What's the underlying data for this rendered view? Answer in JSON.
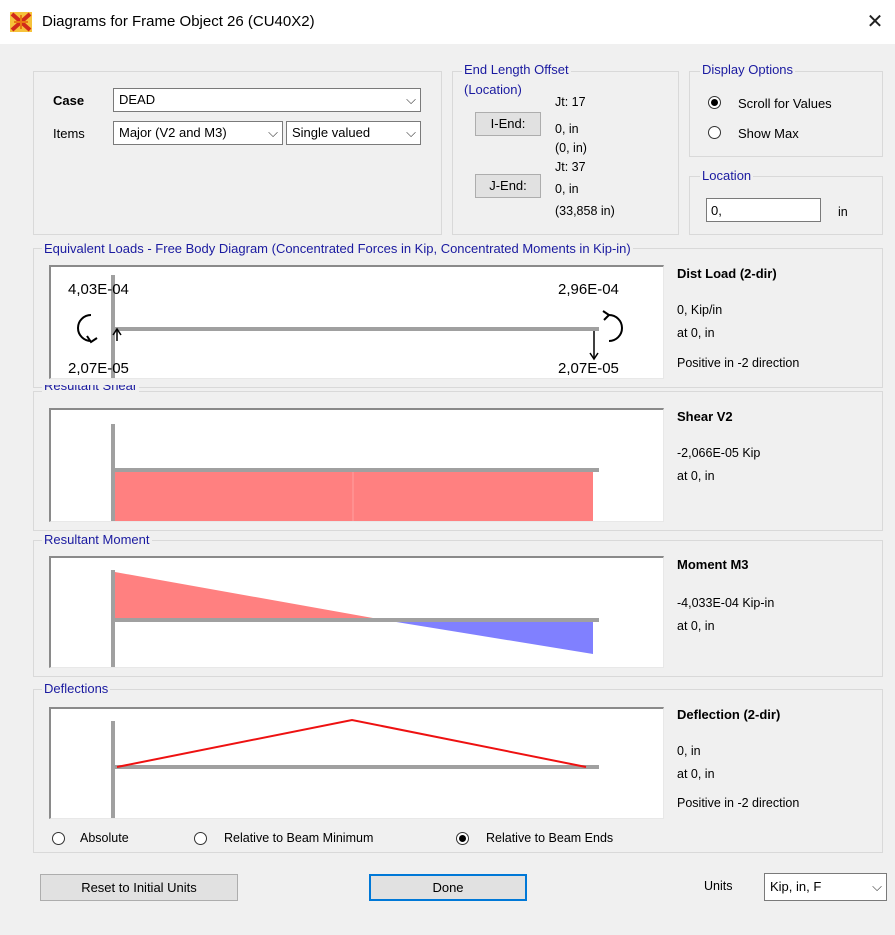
{
  "window": {
    "title": "Diagrams for Frame Object 26  (CU40X2)",
    "close_glyph": "✕"
  },
  "case": {
    "label": "Case",
    "value": "DEAD",
    "items_label": "Items",
    "items_value": "Major (V2 and M3)",
    "valued_value": "Single valued"
  },
  "offset": {
    "title": "End Length Offset",
    "subtitle": "(Location)",
    "i_button": "I-End:",
    "j_button": "J-End:",
    "jt_i": "Jt:  17",
    "i_val": "0, in",
    "i_loc": "(0, in)",
    "jt_j": "Jt:  37",
    "j_val": "0, in",
    "j_loc": "(33,858 in)"
  },
  "display": {
    "title": "Display Options",
    "scroll": "Scroll for Values",
    "show_max": "Show Max"
  },
  "location": {
    "title": "Location",
    "value": "0,",
    "unit": "in"
  },
  "fbd": {
    "title": "Equivalent Loads - Free Body Diagram  (Concentrated Forces in Kip, Concentrated Moments in Kip-in)",
    "tl": "4,03E-04",
    "tr": "2,96E-04",
    "bl": "2,07E-05",
    "br": "2,07E-05",
    "head": "Dist Load (2-dir)",
    "val": "0, Kip/in",
    "at": "at 0, in",
    "note": "Positive in -2 direction"
  },
  "shear": {
    "title": "Resultant Shear",
    "head": "Shear V2",
    "val": "-2,066E-05 Kip",
    "at": "at 0, in"
  },
  "moment": {
    "title": "Resultant Moment",
    "head": "Moment M3",
    "val": "-4,033E-04 Kip-in",
    "at": "at 0, in"
  },
  "deflection": {
    "title": "Deflections",
    "head": "Deflection (2-dir)",
    "val": "0, in",
    "at": "at 0, in",
    "note": "Positive in -2 direction",
    "opt_abs": "Absolute",
    "opt_min": "Relative to Beam Minimum",
    "opt_ends": "Relative to Beam Ends"
  },
  "footer": {
    "reset": "Reset to Initial Units",
    "done": "Done",
    "units_label": "Units",
    "units_value": "Kip, in, F"
  },
  "colors": {
    "positive": "#ff8080",
    "negative": "#8080ff",
    "deflection": "#ee1111",
    "axis": "#a0a0a0",
    "label": "#1a1aa0"
  }
}
